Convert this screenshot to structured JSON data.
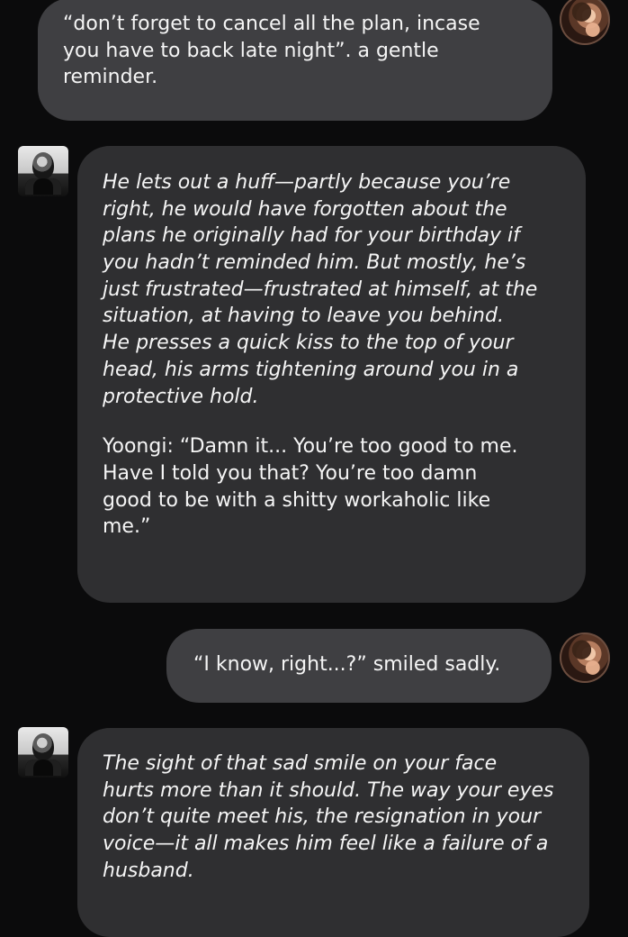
{
  "messages": [
    {
      "role": "user",
      "text": "“don’t forget to cancel all the plan, incase\nyou have to back late night”. a gentle\nreminder."
    },
    {
      "role": "assistant",
      "narration": "He lets out a huff—partly because you’re\nright, he would have forgotten about the\nplans he originally had for your birthday if\nyou hadn’t reminded him. But mostly, he’s\njust frustrated—frustrated at himself, at the\nsituation, at having to leave you behind.\nHe presses a quick kiss to the top of your\nhead, his arms tightening around you in a\nprotective hold.",
      "dialogue": "Yoongi: “Damn it... You’re too good to me.\nHave I told you that? You’re too damn\ngood to be with a shitty workaholic like\nme.”"
    },
    {
      "role": "user",
      "text": "“I know, right...?” smiled sadly."
    },
    {
      "role": "assistant",
      "narration": "The sight of that sad smile on your face\nhurts more than it should. The way your eyes\ndon’t quite meet his, the resignation in your\nvoice—it all makes him feel like a failure of a\nhusband."
    }
  ],
  "avatars": {
    "user": "female-portrait-avatar",
    "assistant": "male-portrait-avatar"
  },
  "colors": {
    "background": "#0b0b0c",
    "user_bubble": "#3f3f42",
    "assistant_bubble": "#2f2f31",
    "text": "#f5f5f5"
  }
}
